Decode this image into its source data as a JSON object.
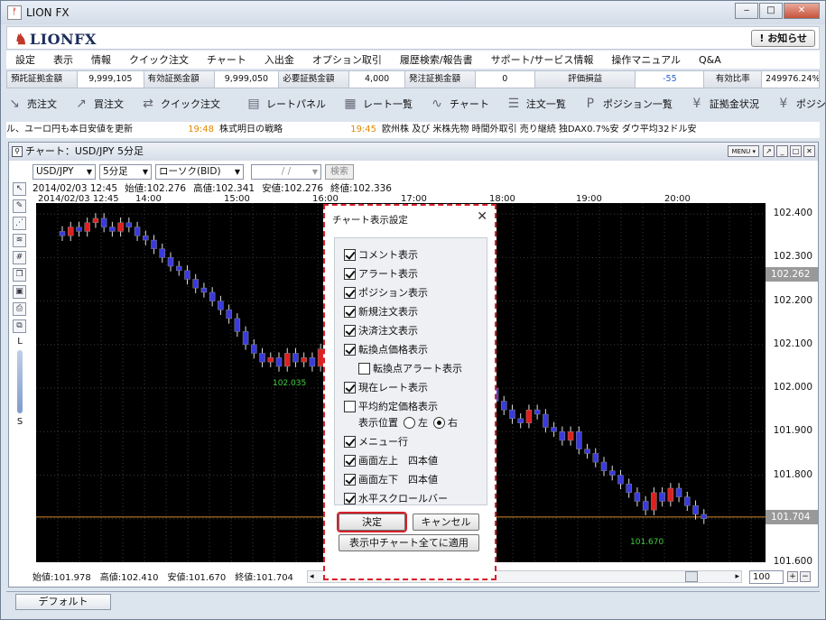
{
  "window": {
    "title": "LION FX",
    "controls": [
      "‒",
      "□",
      "✕"
    ]
  },
  "header": {
    "logo": "LIONFX",
    "notice": "! お知らせ"
  },
  "menu": [
    "設定",
    "表示",
    "情報",
    "クイック注文",
    "チャート",
    "入出金",
    "オプション取引",
    "履歴検索/報告書",
    "サポート/サービス情報",
    "操作マニュアル",
    "Q&A"
  ],
  "status": [
    {
      "label": "預託証拠金額",
      "value": "9,999,105"
    },
    {
      "label": "有効証拠金額",
      "value": "9,999,050"
    },
    {
      "label": "必要証拠金額",
      "value": "4,000"
    },
    {
      "label": "発注証拠金額",
      "value": "0"
    },
    {
      "label": "評価損益",
      "value": "-55"
    },
    {
      "label": "有効比率",
      "value": "249976.24%"
    }
  ],
  "toolbar": [
    {
      "label": "売注文",
      "icon": "sell-arrow-icon",
      "glyph": "↘"
    },
    {
      "label": "買注文",
      "icon": "buy-arrow-icon",
      "glyph": "↗"
    },
    {
      "label": "クイック注文",
      "icon": "quick-order-icon",
      "glyph": "⇄"
    },
    {
      "label": "レートパネル",
      "icon": "rate-panel-icon",
      "glyph": "▤"
    },
    {
      "label": "レート一覧",
      "icon": "rate-list-icon",
      "glyph": "▦"
    },
    {
      "label": "チャート",
      "icon": "chart-icon",
      "glyph": "∿"
    },
    {
      "label": "注文一覧",
      "icon": "order-list-icon",
      "glyph": "☰"
    },
    {
      "label": "ポジション一覧",
      "icon": "position-list-icon",
      "glyph": "P"
    },
    {
      "label": "証拠金状況",
      "icon": "margin-status-icon",
      "glyph": "¥"
    },
    {
      "label": "ポジション集計",
      "icon": "position-summary-icon",
      "glyph": "¥"
    }
  ],
  "ticker": {
    "lead": "ル、ユーロ円も本日安値を更新",
    "items": [
      {
        "time": "19:48",
        "text": "株式明日の戦略"
      },
      {
        "time": "19:45",
        "text": "欧州株 及び 米株先物 時間外取引 売り継続 独DAX0.7%安 ダウ平均32ドル安"
      }
    ]
  },
  "chart_window": {
    "title": "チャート：USD/JPY 5分足",
    "menu_label": "MENU ▾",
    "pair": "USD/JPY",
    "interval": "5分足",
    "candle_type": "ローソク(BID)",
    "date_placeholder": "/ /",
    "search_label": "検索",
    "top_ohlc": {
      "datetime": "2014/02/03 12:45",
      "open": "始値:102.276",
      "high": "高値:102.341",
      "low": "安値:102.276",
      "close": "終値:102.336"
    },
    "bottom_ohlc": {
      "open": "始値:101.978",
      "high": "高値:102.410",
      "low": "安値:101.670",
      "close": "終値:101.704"
    },
    "zoom": "100",
    "tool_labels": {
      "l": "L",
      "s": "S"
    }
  },
  "chart_data": {
    "type": "candlestick",
    "pair": "USD/JPY",
    "x_labels": [
      "2014/02/03 12:45",
      "14:00",
      "15:00",
      "16:00",
      "17:00",
      "18:00",
      "19:00",
      "20:00"
    ],
    "y_ticks": [
      "102.400",
      "102.300",
      "102.200",
      "102.100",
      "102.000",
      "101.900",
      "101.800",
      "101.700",
      "101.600"
    ],
    "ylim": [
      101.6,
      102.45
    ],
    "current_price": "102.262",
    "horizontal_line": "101.704",
    "annotations": [
      {
        "label": "102.035",
        "value": 102.035
      },
      {
        "label": "101.670",
        "value": 101.67
      }
    ],
    "closes": [
      102.35,
      102.37,
      102.36,
      102.38,
      102.39,
      102.37,
      102.36,
      102.38,
      102.37,
      102.35,
      102.34,
      102.32,
      102.3,
      102.28,
      102.27,
      102.25,
      102.23,
      102.22,
      102.2,
      102.18,
      102.16,
      102.13,
      102.1,
      102.08,
      102.06,
      102.07,
      102.05,
      102.08,
      102.06,
      102.07,
      102.05,
      102.09,
      102.12,
      102.15,
      102.2,
      102.24,
      102.25,
      102.22,
      102.2,
      102.18,
      102.15,
      102.12,
      102.1,
      102.08,
      102.06,
      102.05,
      102.07,
      102.04,
      102.02,
      102.0,
      101.98,
      102.0,
      101.97,
      101.95,
      101.93,
      101.92,
      101.95,
      101.94,
      101.91,
      101.9,
      101.88,
      101.9,
      101.86,
      101.85,
      101.83,
      101.81,
      101.8,
      101.78,
      101.76,
      101.74,
      101.72,
      101.76,
      101.74,
      101.77,
      101.75,
      101.73,
      101.71,
      101.7
    ]
  },
  "dialog": {
    "title": "チャート表示設定",
    "options": [
      {
        "label": "コメント表示",
        "checked": true,
        "indent": false
      },
      {
        "label": "アラート表示",
        "checked": true,
        "indent": false
      },
      {
        "label": "ポジション表示",
        "checked": true,
        "indent": false
      },
      {
        "label": "新規注文表示",
        "checked": true,
        "indent": false
      },
      {
        "label": "決済注文表示",
        "checked": true,
        "indent": false
      },
      {
        "label": "転換点価格表示",
        "checked": true,
        "indent": false
      },
      {
        "label": "転換点アラート表示",
        "checked": false,
        "indent": true
      },
      {
        "label": "現在レート表示",
        "checked": true,
        "indent": false
      },
      {
        "label": "平均約定価格表示",
        "checked": false,
        "indent": false
      }
    ],
    "position": {
      "label": "表示位置",
      "left": "左",
      "right": "右",
      "selected": "right"
    },
    "options2": [
      {
        "label": "メニュー行",
        "checked": true
      },
      {
        "label": "画面左上　四本値",
        "checked": true
      },
      {
        "label": "画面左下　四本値",
        "checked": true
      },
      {
        "label": "水平スクロールバー",
        "checked": true
      }
    ],
    "ok_label": "決定",
    "cancel_label": "キャンセル",
    "apply_all_label": "表示中チャート全てに適用"
  },
  "tabs": [
    "デフォルト"
  ]
}
